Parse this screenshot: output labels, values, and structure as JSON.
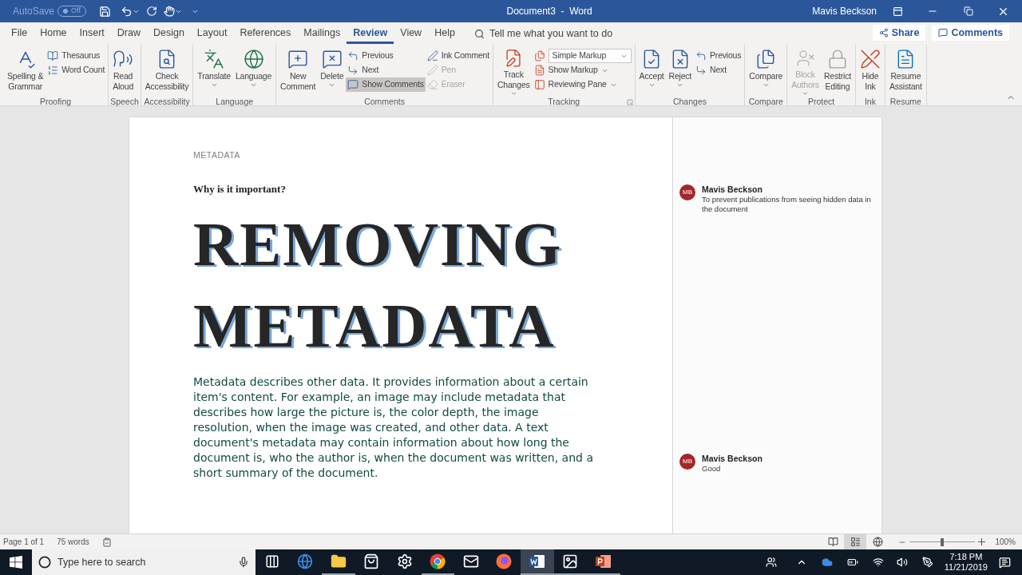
{
  "title_bar": {
    "autosave_label": "AutoSave",
    "autosave_state": "Off",
    "autosave_on": false,
    "document_title": "Document3  -  Word",
    "user": "Mavis Beckson"
  },
  "tabs": [
    {
      "label": "File",
      "selected": false
    },
    {
      "label": "Home",
      "selected": false
    },
    {
      "label": "Insert",
      "selected": false
    },
    {
      "label": "Draw",
      "selected": false
    },
    {
      "label": "Design",
      "selected": false
    },
    {
      "label": "Layout",
      "selected": false
    },
    {
      "label": "References",
      "selected": false
    },
    {
      "label": "Mailings",
      "selected": false
    },
    {
      "label": "Review",
      "selected": true
    },
    {
      "label": "View",
      "selected": false
    },
    {
      "label": "Help",
      "selected": false
    }
  ],
  "tell_me": {
    "placeholder": "Tell me what you want to do"
  },
  "share_button": "Share",
  "comments_button": "Comments",
  "ribbon": [
    {
      "label": "Proofing",
      "items": [
        {
          "kind": "large",
          "label": "Spelling &\nGrammar",
          "menu": false,
          "disabled": false
        },
        {
          "kind": "stack",
          "items": [
            {
              "label": "Thesaurus",
              "disabled": false,
              "selected": false,
              "menu": false
            },
            {
              "label": "Word Count",
              "disabled": false,
              "selected": false,
              "menu": false
            }
          ]
        }
      ]
    },
    {
      "label": "Speech",
      "items": [
        {
          "kind": "large",
          "label": "Read\nAloud",
          "menu": false,
          "disabled": false
        }
      ]
    },
    {
      "label": "Accessibility",
      "items": [
        {
          "kind": "large",
          "label": "Check\nAccessibility",
          "menu": false,
          "disabled": false
        }
      ]
    },
    {
      "label": "Language",
      "items": [
        {
          "kind": "large",
          "label": "Translate",
          "menu": true,
          "disabled": false
        },
        {
          "kind": "large",
          "label": "Language",
          "menu": true,
          "disabled": false
        }
      ]
    },
    {
      "label": "Comments",
      "items": [
        {
          "kind": "large",
          "label": "New\nComment",
          "menu": false,
          "disabled": false
        },
        {
          "kind": "large",
          "label": "Delete",
          "menu": true,
          "disabled": false
        },
        {
          "kind": "stack",
          "items": [
            {
              "label": "Previous",
              "disabled": false,
              "selected": false,
              "menu": false
            },
            {
              "label": "Next",
              "disabled": false,
              "selected": false,
              "menu": false
            },
            {
              "label": "Show Comments",
              "disabled": false,
              "selected": true,
              "menu": false
            }
          ]
        },
        {
          "kind": "stack",
          "items": [
            {
              "label": "Ink Comment",
              "disabled": false,
              "selected": false,
              "menu": false
            },
            {
              "label": "Pen",
              "disabled": true,
              "selected": false,
              "menu": false
            },
            {
              "label": "Eraser",
              "disabled": true,
              "selected": false,
              "menu": false
            }
          ]
        }
      ]
    },
    {
      "label": "Tracking",
      "launcher": true,
      "items": [
        {
          "kind": "large",
          "label": "Track\nChanges",
          "menu": true,
          "disabled": false
        },
        {
          "kind": "stack",
          "items": [
            {
              "label": "Simple Markup",
              "kind": "dropdown",
              "disabled": false,
              "selected": false
            },
            {
              "label": "Show Markup",
              "disabled": false,
              "selected": false,
              "menu": true
            },
            {
              "label": "Reviewing Pane",
              "disabled": false,
              "selected": false,
              "menu": true
            }
          ]
        }
      ]
    },
    {
      "label": "Changes",
      "items": [
        {
          "kind": "large",
          "label": "Accept",
          "menu": true,
          "disabled": false
        },
        {
          "kind": "large",
          "label": "Reject",
          "menu": true,
          "disabled": false
        },
        {
          "kind": "stack",
          "items": [
            {
              "label": "Previous",
              "disabled": false,
              "selected": false,
              "menu": false
            },
            {
              "label": "Next",
              "disabled": false,
              "selected": false,
              "menu": false
            }
          ]
        }
      ]
    },
    {
      "label": "Compare",
      "items": [
        {
          "kind": "large",
          "label": "Compare",
          "menu": true,
          "disabled": false
        }
      ]
    },
    {
      "label": "Protect",
      "items": [
        {
          "kind": "large",
          "label": "Block\nAuthors",
          "menu": true,
          "disabled": true
        },
        {
          "kind": "large",
          "label": "Restrict\nEditing",
          "menu": false,
          "disabled": false
        }
      ]
    },
    {
      "label": "Ink",
      "items": [
        {
          "kind": "large",
          "label": "Hide\nInk",
          "menu": false,
          "disabled": false
        }
      ]
    },
    {
      "label": "Resume",
      "items": [
        {
          "kind": "large",
          "label": "Resume\nAssistant",
          "menu": false,
          "disabled": false
        }
      ]
    }
  ],
  "document": {
    "header": "METADATA",
    "subtitle": "Why is it important?",
    "title": "REMOVING METADATA",
    "body": "Metadata describes other data. It provides information about a certain item's content. For example, an image may include metadata that describes how large the picture is, the color depth, the image resolution, when the image was created, and other data. A text document's metadata may contain information about how long the document is, who the author is, when the document was written, and a short summary of the document."
  },
  "comments": [
    {
      "initials": "MB",
      "author": "Mavis Beckson",
      "text": "To prevent publications from seeing hidden data in the document"
    },
    {
      "initials": "MB",
      "author": "Mavis Beckson",
      "text": "Good"
    }
  ],
  "status_bar": {
    "page": "Page 1 of 1",
    "words": "75 words",
    "views": [
      {
        "kind": "read",
        "selected": false
      },
      {
        "kind": "print",
        "selected": true
      },
      {
        "kind": "web",
        "selected": false
      }
    ],
    "zoom": {
      "level": 0.5,
      "reading": "100%"
    }
  },
  "taskbar": {
    "search_placeholder": "Type here to search",
    "apps": [
      {
        "kind": "task_view",
        "running": false,
        "active": false
      },
      {
        "kind": "edge",
        "running": false,
        "active": false
      },
      {
        "kind": "explorer",
        "running": true,
        "active": false
      },
      {
        "kind": "store",
        "running": false,
        "active": false
      },
      {
        "kind": "settings",
        "running": false,
        "active": false
      },
      {
        "kind": "chrome",
        "running": true,
        "active": false
      },
      {
        "kind": "mail",
        "running": false,
        "active": false
      },
      {
        "kind": "firefox",
        "running": false,
        "active": false
      },
      {
        "kind": "word",
        "running": true,
        "active": true
      },
      {
        "kind": "photos",
        "running": true,
        "active": false
      },
      {
        "kind": "powerpoint",
        "running": true,
        "active": false
      }
    ],
    "time": "7:18 PM",
    "date": "11/21/2019"
  }
}
